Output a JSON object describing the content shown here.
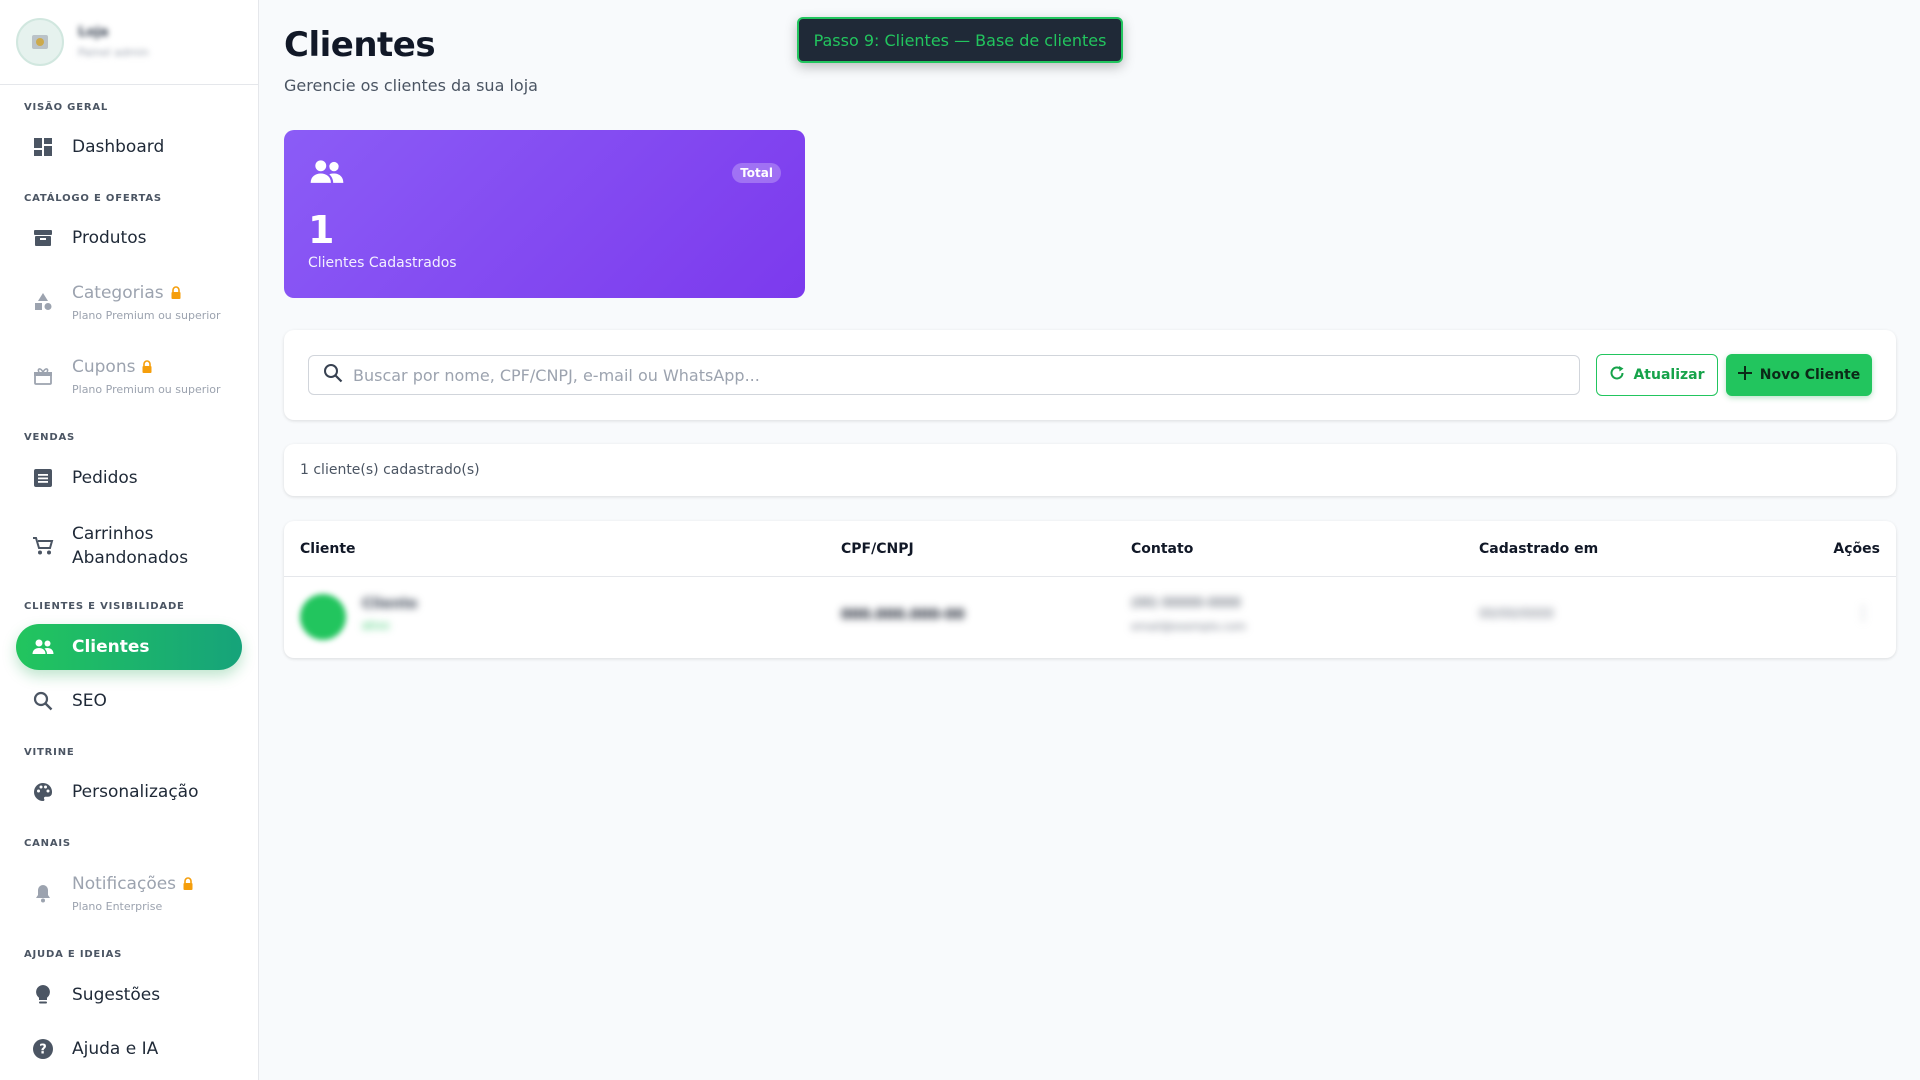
{
  "sidebar": {
    "store": {
      "name": "Loja",
      "subtitle": "Painel admin"
    },
    "sections": {
      "overview": "VISÃO GERAL",
      "catalog": "CATÁLOGO E OFERTAS",
      "sales": "VENDAS",
      "clients": "CLIENTES E VISIBILIDADE",
      "storefront": "VITRINE",
      "channels": "CANAIS",
      "help": "AJUDA E IDEIAS"
    },
    "items": {
      "dashboard": "Dashboard",
      "products": "Produtos",
      "categories": "Categorias",
      "categories_sub": "Plano Premium ou superior",
      "coupons": "Cupons",
      "coupons_sub": "Plano Premium ou superior",
      "orders": "Pedidos",
      "carts_line1": "Carrinhos",
      "carts_line2": "Abandonados",
      "clients": "Clientes",
      "seo": "SEO",
      "customization": "Personalização",
      "notifications": "Notificações",
      "notifications_sub": "Plano Enterprise",
      "suggestions": "Sugestões",
      "help": "Ajuda e IA"
    }
  },
  "page": {
    "title": "Clientes",
    "subtitle": "Gerencie os clientes da sua loja"
  },
  "toast": "Passo 9: Clientes — Base de clientes",
  "stat": {
    "badge": "Total",
    "value": "1",
    "label": "Clientes Cadastrados"
  },
  "search": {
    "placeholder": "Buscar por nome, CPF/CNPJ, e-mail ou WhatsApp...",
    "refresh_label": "Atualizar",
    "new_label": "Novo Cliente"
  },
  "count_text": "1 cliente(s) cadastrado(s)",
  "table": {
    "headers": [
      "Cliente",
      "CPF/CNPJ",
      "Contato",
      "Cadastrado em",
      "Ações"
    ],
    "rows": [
      {
        "name": "Cliente",
        "tag": "ativo",
        "document": "000.000.000-00",
        "phone": "(00) 00000-0000",
        "email": "email@exemplo.com",
        "date": "00/00/0000"
      }
    ]
  },
  "colors": {
    "accent": "#22c55e",
    "stat_card": "#8b5cf6",
    "toast_bg": "#1f2937"
  }
}
